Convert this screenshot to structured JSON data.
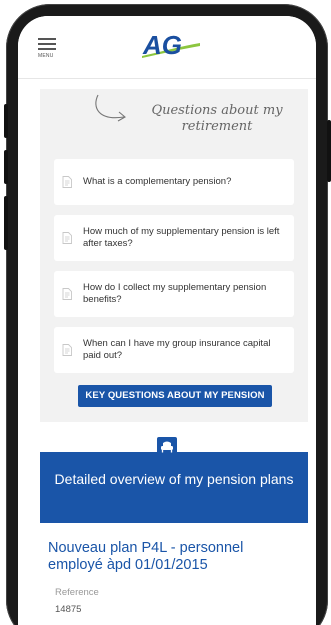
{
  "header": {
    "menu_label": "MENU",
    "logo_text": "AG"
  },
  "questions": {
    "title": "Questions about my retirement",
    "items": [
      "What is a complementary pension?",
      "How much of my supplementary pension is left after taxes?",
      "How do I collect my supplementary pension benefits?",
      "When can I have my group insurance capital paid out?"
    ],
    "button_label": "KEY QUESTIONS ABOUT MY PENSION"
  },
  "overview": {
    "title": "Detailed overview of my pension plans"
  },
  "plan": {
    "name": "Nouveau plan P4L - personnel employé àpd 01/01/2015",
    "reference_label": "Reference",
    "reference_value": "14875"
  },
  "colors": {
    "brand_blue": "#1a55a8",
    "logo_green": "#8cc63f",
    "block_bg": "#f2f2f2"
  },
  "icons": {
    "menu": "hamburger-icon",
    "question": "document-icon",
    "overview": "armchair-icon",
    "title_decoration": "hand-drawn-arrow-icon"
  }
}
